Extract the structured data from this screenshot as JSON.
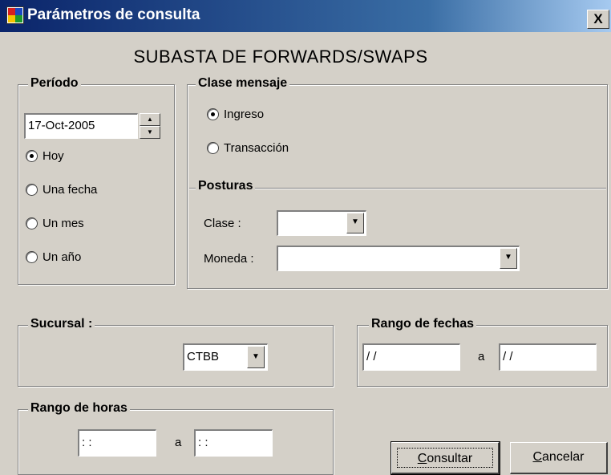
{
  "window": {
    "title": "Parámetros de consulta",
    "close": "X"
  },
  "heading": "SUBASTA  DE FORWARDS/SWAPS",
  "periodo": {
    "legend": "Período",
    "date_value": "17-Oct-2005",
    "options": [
      "Hoy",
      "Una fecha",
      "Un mes",
      "Un año"
    ],
    "selected": "Hoy"
  },
  "clase_mensaje": {
    "legend": "Clase mensaje",
    "options": [
      "Ingreso",
      "Transacción"
    ],
    "selected": "Ingreso"
  },
  "posturas": {
    "legend": "Posturas",
    "clase_label": "Clase :",
    "clase_value": "",
    "moneda_label": "Moneda :",
    "moneda_value": ""
  },
  "sucursal": {
    "legend": "Sucursal :",
    "value": "CTBB"
  },
  "rango_fechas": {
    "legend": "Rango de fechas",
    "from": "/ /",
    "sep": "a",
    "to": "/ /"
  },
  "rango_horas": {
    "legend": "Rango de horas",
    "from": ": :",
    "sep": "a",
    "to": ": :"
  },
  "buttons": {
    "consultar": {
      "accel": "C",
      "rest": "onsultar"
    },
    "cancelar": {
      "accel": "C",
      "rest": "ancelar"
    }
  }
}
